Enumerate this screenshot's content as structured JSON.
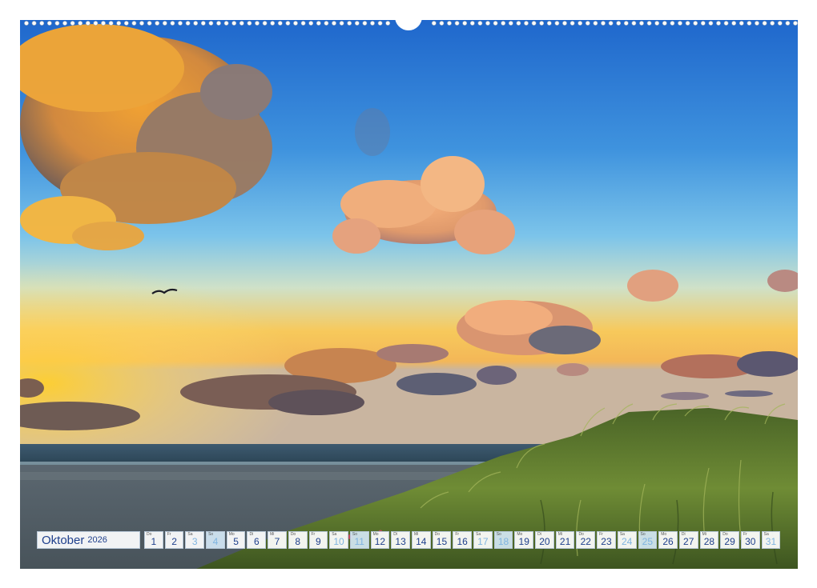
{
  "calendar": {
    "month": "Oktober",
    "year": "2026",
    "days": [
      {
        "wd": "Do",
        "num": "1"
      },
      {
        "wd": "Fr",
        "num": "2"
      },
      {
        "wd": "Sa",
        "num": "3"
      },
      {
        "wd": "So",
        "num": "4"
      },
      {
        "wd": "Mo",
        "num": "5"
      },
      {
        "wd": "Di",
        "num": "6"
      },
      {
        "wd": "Mi",
        "num": "7"
      },
      {
        "wd": "Do",
        "num": "8"
      },
      {
        "wd": "Fr",
        "num": "9"
      },
      {
        "wd": "Sa",
        "num": "10"
      },
      {
        "wd": "So",
        "num": "11"
      },
      {
        "wd": "Mo",
        "num": "12"
      },
      {
        "wd": "Di",
        "num": "13"
      },
      {
        "wd": "Mi",
        "num": "14"
      },
      {
        "wd": "Do",
        "num": "15"
      },
      {
        "wd": "Fr",
        "num": "16"
      },
      {
        "wd": "Sa",
        "num": "17"
      },
      {
        "wd": "So",
        "num": "18"
      },
      {
        "wd": "Mo",
        "num": "19"
      },
      {
        "wd": "Di",
        "num": "20"
      },
      {
        "wd": "Mi",
        "num": "21"
      },
      {
        "wd": "Do",
        "num": "22"
      },
      {
        "wd": "Fr",
        "num": "23"
      },
      {
        "wd": "Sa",
        "num": "24"
      },
      {
        "wd": "So",
        "num": "25"
      },
      {
        "wd": "Mo",
        "num": "26"
      },
      {
        "wd": "Di",
        "num": "27"
      },
      {
        "wd": "Mi",
        "num": "28"
      },
      {
        "wd": "Do",
        "num": "29"
      },
      {
        "wd": "Fr",
        "num": "30"
      },
      {
        "wd": "Sa",
        "num": "31"
      }
    ]
  },
  "colors": {
    "sky_top": "#1e6fd0",
    "sky_mid": "#5db0e6",
    "horizon_glow": "#ffd24a",
    "sea": "#2d4a5c",
    "grass": "#5f7d2e",
    "text_blue": "#1e3f8c"
  }
}
